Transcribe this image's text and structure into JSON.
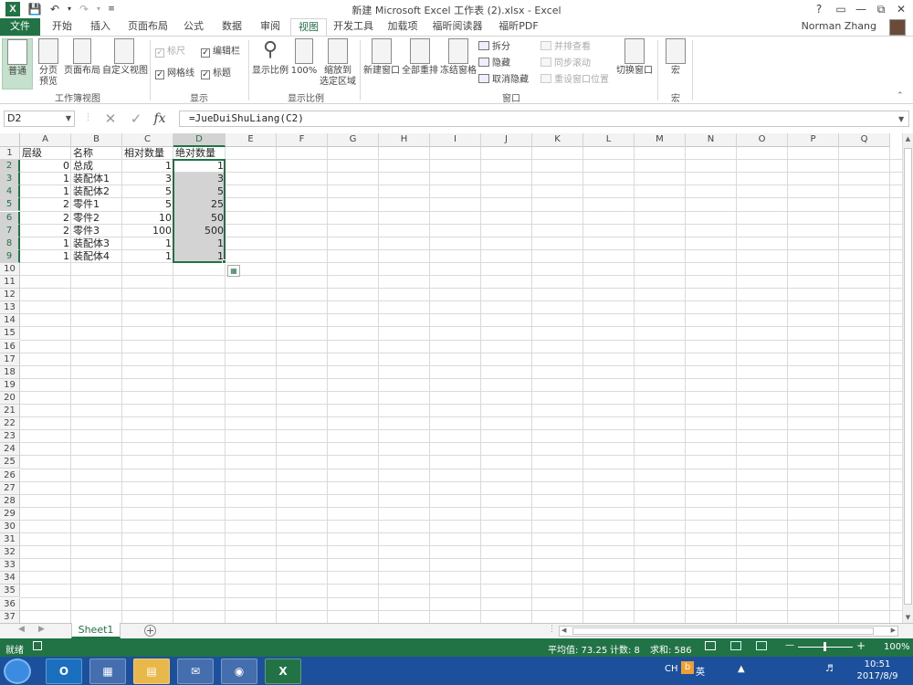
{
  "window": {
    "title": "新建 Microsoft Excel 工作表 (2).xlsx - Excel",
    "help": "?",
    "user": "Norman Zhang"
  },
  "tabs": [
    "文件",
    "开始",
    "插入",
    "页面布局",
    "公式",
    "数据",
    "审阅",
    "视图",
    "开发工具",
    "加载项",
    "福昕阅读器",
    "福昕PDF"
  ],
  "active_tab": "视图",
  "ribbon": {
    "workbook_views": {
      "normal": "普通",
      "page_break": "分页\n预览",
      "page_layout": "页面布局",
      "custom": "自定义视图",
      "group": "工作簿视图"
    },
    "show": {
      "ruler": "标尺",
      "formula_bar": "编辑栏",
      "gridlines": "网格线",
      "headings": "标题",
      "group": "显示"
    },
    "zoom": {
      "zoom": "显示比例",
      "zoom100": "100%",
      "zoom_selection": "缩放到\n选定区域",
      "group": "显示比例"
    },
    "window": {
      "new_window": "新建窗口",
      "arrange_all": "全部重排",
      "freeze": "冻结窗格",
      "split": "拆分",
      "hide": "隐藏",
      "unhide": "取消隐藏",
      "side_by_side": "并排查看",
      "sync_scroll": "同步滚动",
      "reset_position": "重设窗口位置",
      "switch": "切换窗口",
      "group": "窗口"
    },
    "macros": {
      "macros": "宏",
      "group": "宏"
    }
  },
  "formula_bar": {
    "name_box": "D2",
    "formula": "=JueDuiShuLiang(C2)",
    "fx": "fx"
  },
  "columns": [
    "A",
    "B",
    "C",
    "D",
    "E",
    "F",
    "G",
    "H",
    "I",
    "J",
    "K",
    "L",
    "M",
    "N",
    "O",
    "P",
    "Q"
  ],
  "rows": [
    "1",
    "2",
    "3",
    "4",
    "5",
    "6",
    "7",
    "8",
    "9",
    "10",
    "11",
    "12",
    "13",
    "14",
    "15",
    "16",
    "17",
    "18",
    "19",
    "20",
    "21",
    "22",
    "23",
    "24",
    "25",
    "26",
    "27",
    "28",
    "29",
    "30",
    "31",
    "32",
    "33",
    "34",
    "35",
    "36",
    "37"
  ],
  "sheet": {
    "headers": {
      "A": "层级",
      "B": "名称",
      "C": "相对数量",
      "D": "绝对数量"
    },
    "data": [
      {
        "level": "0",
        "name": "总成",
        "rel": "1",
        "abs": "1"
      },
      {
        "level": "1",
        "name": "装配体1",
        "rel": "3",
        "abs": "3"
      },
      {
        "level": "1",
        "name": "装配体2",
        "rel": "5",
        "abs": "5"
      },
      {
        "level": "2",
        "name": "零件1",
        "rel": "5",
        "abs": "25"
      },
      {
        "level": "2",
        "name": "零件2",
        "rel": "10",
        "abs": "50"
      },
      {
        "level": "2",
        "name": "零件3",
        "rel": "100",
        "abs": "500"
      },
      {
        "level": "1",
        "name": "装配体3",
        "rel": "1",
        "abs": "1"
      },
      {
        "level": "1",
        "name": "装配体4",
        "rel": "1",
        "abs": "1"
      }
    ]
  },
  "sheet_tab": "Sheet1",
  "status": {
    "ready": "就绪",
    "average": "平均值: 73.25",
    "count": "计数: 8",
    "sum": "求和: 586",
    "zoom": "100%"
  },
  "taskbar": {
    "ime": "CH",
    "ime_mode": "英",
    "time": "10:51",
    "date": "2017/8/9"
  },
  "colors": {
    "excel_green": "#217346",
    "selection_gray": "#d3d3d3",
    "taskbar_blue": "#1c4f9c"
  }
}
